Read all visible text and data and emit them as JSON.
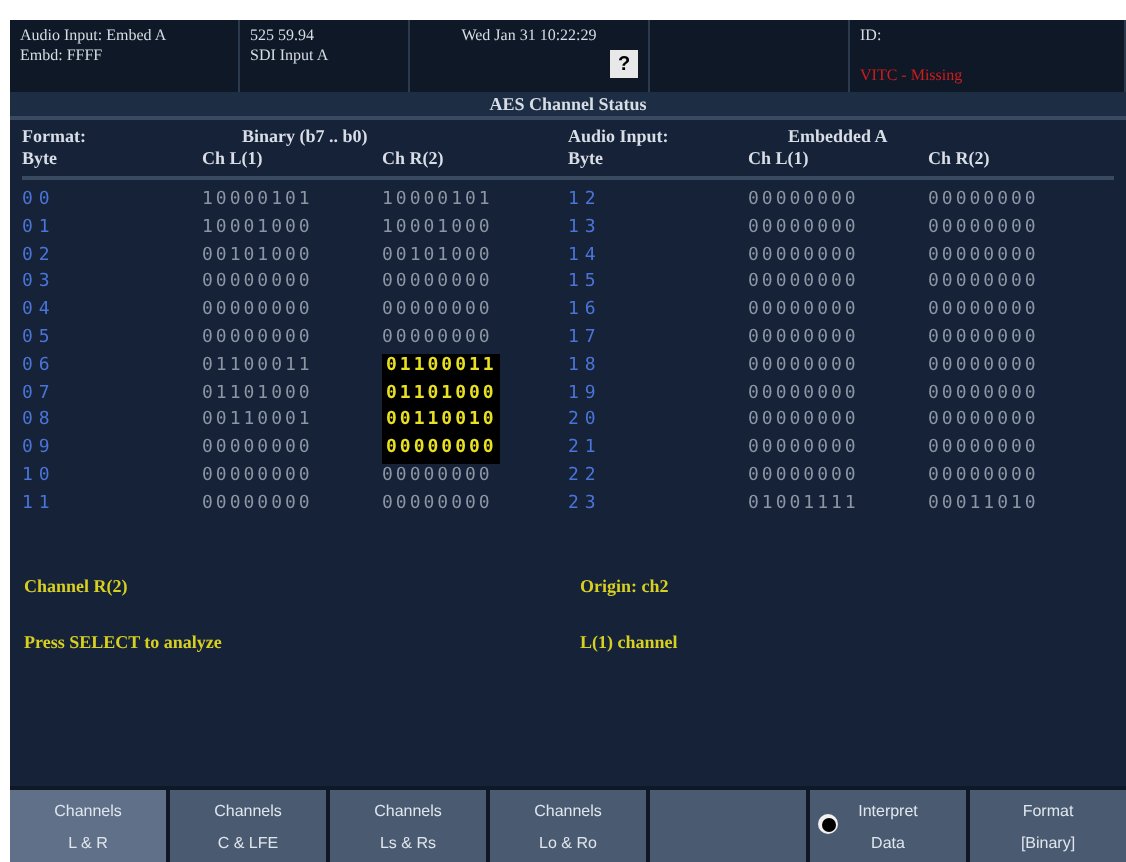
{
  "header": {
    "input": [
      "Audio Input: Embed A",
      "Embd: FFFF"
    ],
    "format": [
      "525 59.94",
      "SDI Input A"
    ],
    "datetime": "Wed Jan 31 10:22:29",
    "help": "?",
    "id_label": "ID:",
    "warning": "VITC - Missing"
  },
  "title": "AES Channel Status",
  "left": {
    "format_label": "Format:",
    "format_value": "Binary (b7 .. b0)",
    "byte_label": "Byte",
    "col_l": "Ch L(1)",
    "col_r": "Ch R(2)",
    "rows": [
      {
        "byte": "00",
        "l": "10000101",
        "r": "10000101",
        "highlighted": false
      },
      {
        "byte": "01",
        "l": "10001000",
        "r": "10001000",
        "highlighted": false
      },
      {
        "byte": "02",
        "l": "00101000",
        "r": "00101000",
        "highlighted": false
      },
      {
        "byte": "03",
        "l": "00000000",
        "r": "00000000",
        "highlighted": false
      },
      {
        "byte": "04",
        "l": "00000000",
        "r": "00000000",
        "highlighted": false
      },
      {
        "byte": "05",
        "l": "00000000",
        "r": "00000000",
        "highlighted": false
      },
      {
        "byte": "06",
        "l": "01100011",
        "r": "01100011",
        "highlighted": true
      },
      {
        "byte": "07",
        "l": "01101000",
        "r": "01101000",
        "highlighted": true
      },
      {
        "byte": "08",
        "l": "00110001",
        "r": "00110010",
        "highlighted": true
      },
      {
        "byte": "09",
        "l": "00000000",
        "r": "00000000",
        "highlighted": true
      },
      {
        "byte": "10",
        "l": "00000000",
        "r": "00000000",
        "highlighted": false
      },
      {
        "byte": "11",
        "l": "00000000",
        "r": "00000000",
        "highlighted": false
      }
    ]
  },
  "right": {
    "format_label": "Audio Input:",
    "format_value": "Embedded A",
    "byte_label": "Byte",
    "col_l": "Ch L(1)",
    "col_r": "Ch R(2)",
    "rows": [
      {
        "byte": "12",
        "l": "00000000",
        "r": "00000000",
        "highlighted": false
      },
      {
        "byte": "13",
        "l": "00000000",
        "r": "00000000",
        "highlighted": false
      },
      {
        "byte": "14",
        "l": "00000000",
        "r": "00000000",
        "highlighted": false
      },
      {
        "byte": "15",
        "l": "00000000",
        "r": "00000000",
        "highlighted": false
      },
      {
        "byte": "16",
        "l": "00000000",
        "r": "00000000",
        "highlighted": false
      },
      {
        "byte": "17",
        "l": "00000000",
        "r": "00000000",
        "highlighted": false
      },
      {
        "byte": "18",
        "l": "00000000",
        "r": "00000000",
        "highlighted": false
      },
      {
        "byte": "19",
        "l": "00000000",
        "r": "00000000",
        "highlighted": false
      },
      {
        "byte": "20",
        "l": "00000000",
        "r": "00000000",
        "highlighted": false
      },
      {
        "byte": "21",
        "l": "00000000",
        "r": "00000000",
        "highlighted": false
      },
      {
        "byte": "22",
        "l": "00000000",
        "r": "00000000",
        "highlighted": false
      },
      {
        "byte": "23",
        "l": "01001111",
        "r": "00011010",
        "highlighted": false
      }
    ]
  },
  "messages": [
    [
      "Channel R(2)",
      "Origin: ch2"
    ],
    [
      "Press SELECT to analyze",
      "L(1) channel"
    ]
  ],
  "softkeys": [
    {
      "kind": "key",
      "lines": [
        "Channels",
        "L & R"
      ],
      "selected": true
    },
    {
      "kind": "key",
      "lines": [
        "Channels",
        "C & LFE"
      ],
      "selected": false
    },
    {
      "kind": "key",
      "lines": [
        "Channels",
        "Ls & Rs"
      ],
      "selected": false
    },
    {
      "kind": "key",
      "lines": [
        "Channels",
        "Lo & Ro"
      ],
      "selected": false
    },
    {
      "kind": "blank",
      "selected": false
    },
    {
      "kind": "radio",
      "lines": [
        "Interpret",
        "Data"
      ],
      "selected": false,
      "checked": true
    },
    {
      "kind": "key",
      "lines": [
        "Format",
        "[Binary]"
      ],
      "selected": false
    }
  ]
}
